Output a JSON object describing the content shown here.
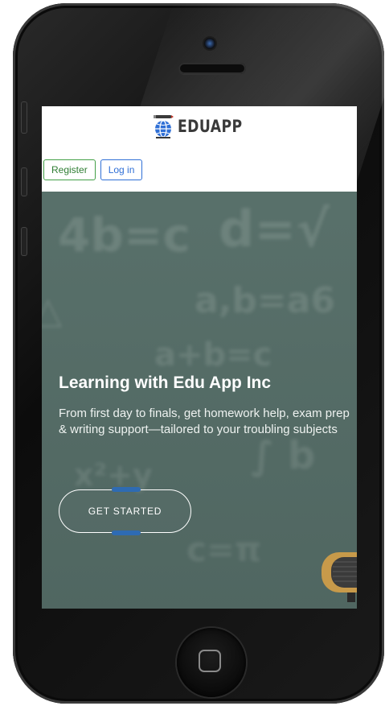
{
  "app": {
    "logo_text": "EDUAPP"
  },
  "header": {
    "register_label": "Register",
    "login_label": "Log in"
  },
  "hero": {
    "title": "Learning with Edu App Inc",
    "subtitle": "From first day to finals, get homework help, exam prep & writing support—tailored to your troubling subjects",
    "cta_label": "GET STARTED"
  },
  "colors": {
    "register_border": "#43a047",
    "login_border": "#2f6fd6",
    "hero_bg": "#5a726c",
    "accent": "#2e6bb3"
  },
  "icons": {
    "logo": "globe-pencil-icon",
    "home": "home-button-icon"
  }
}
